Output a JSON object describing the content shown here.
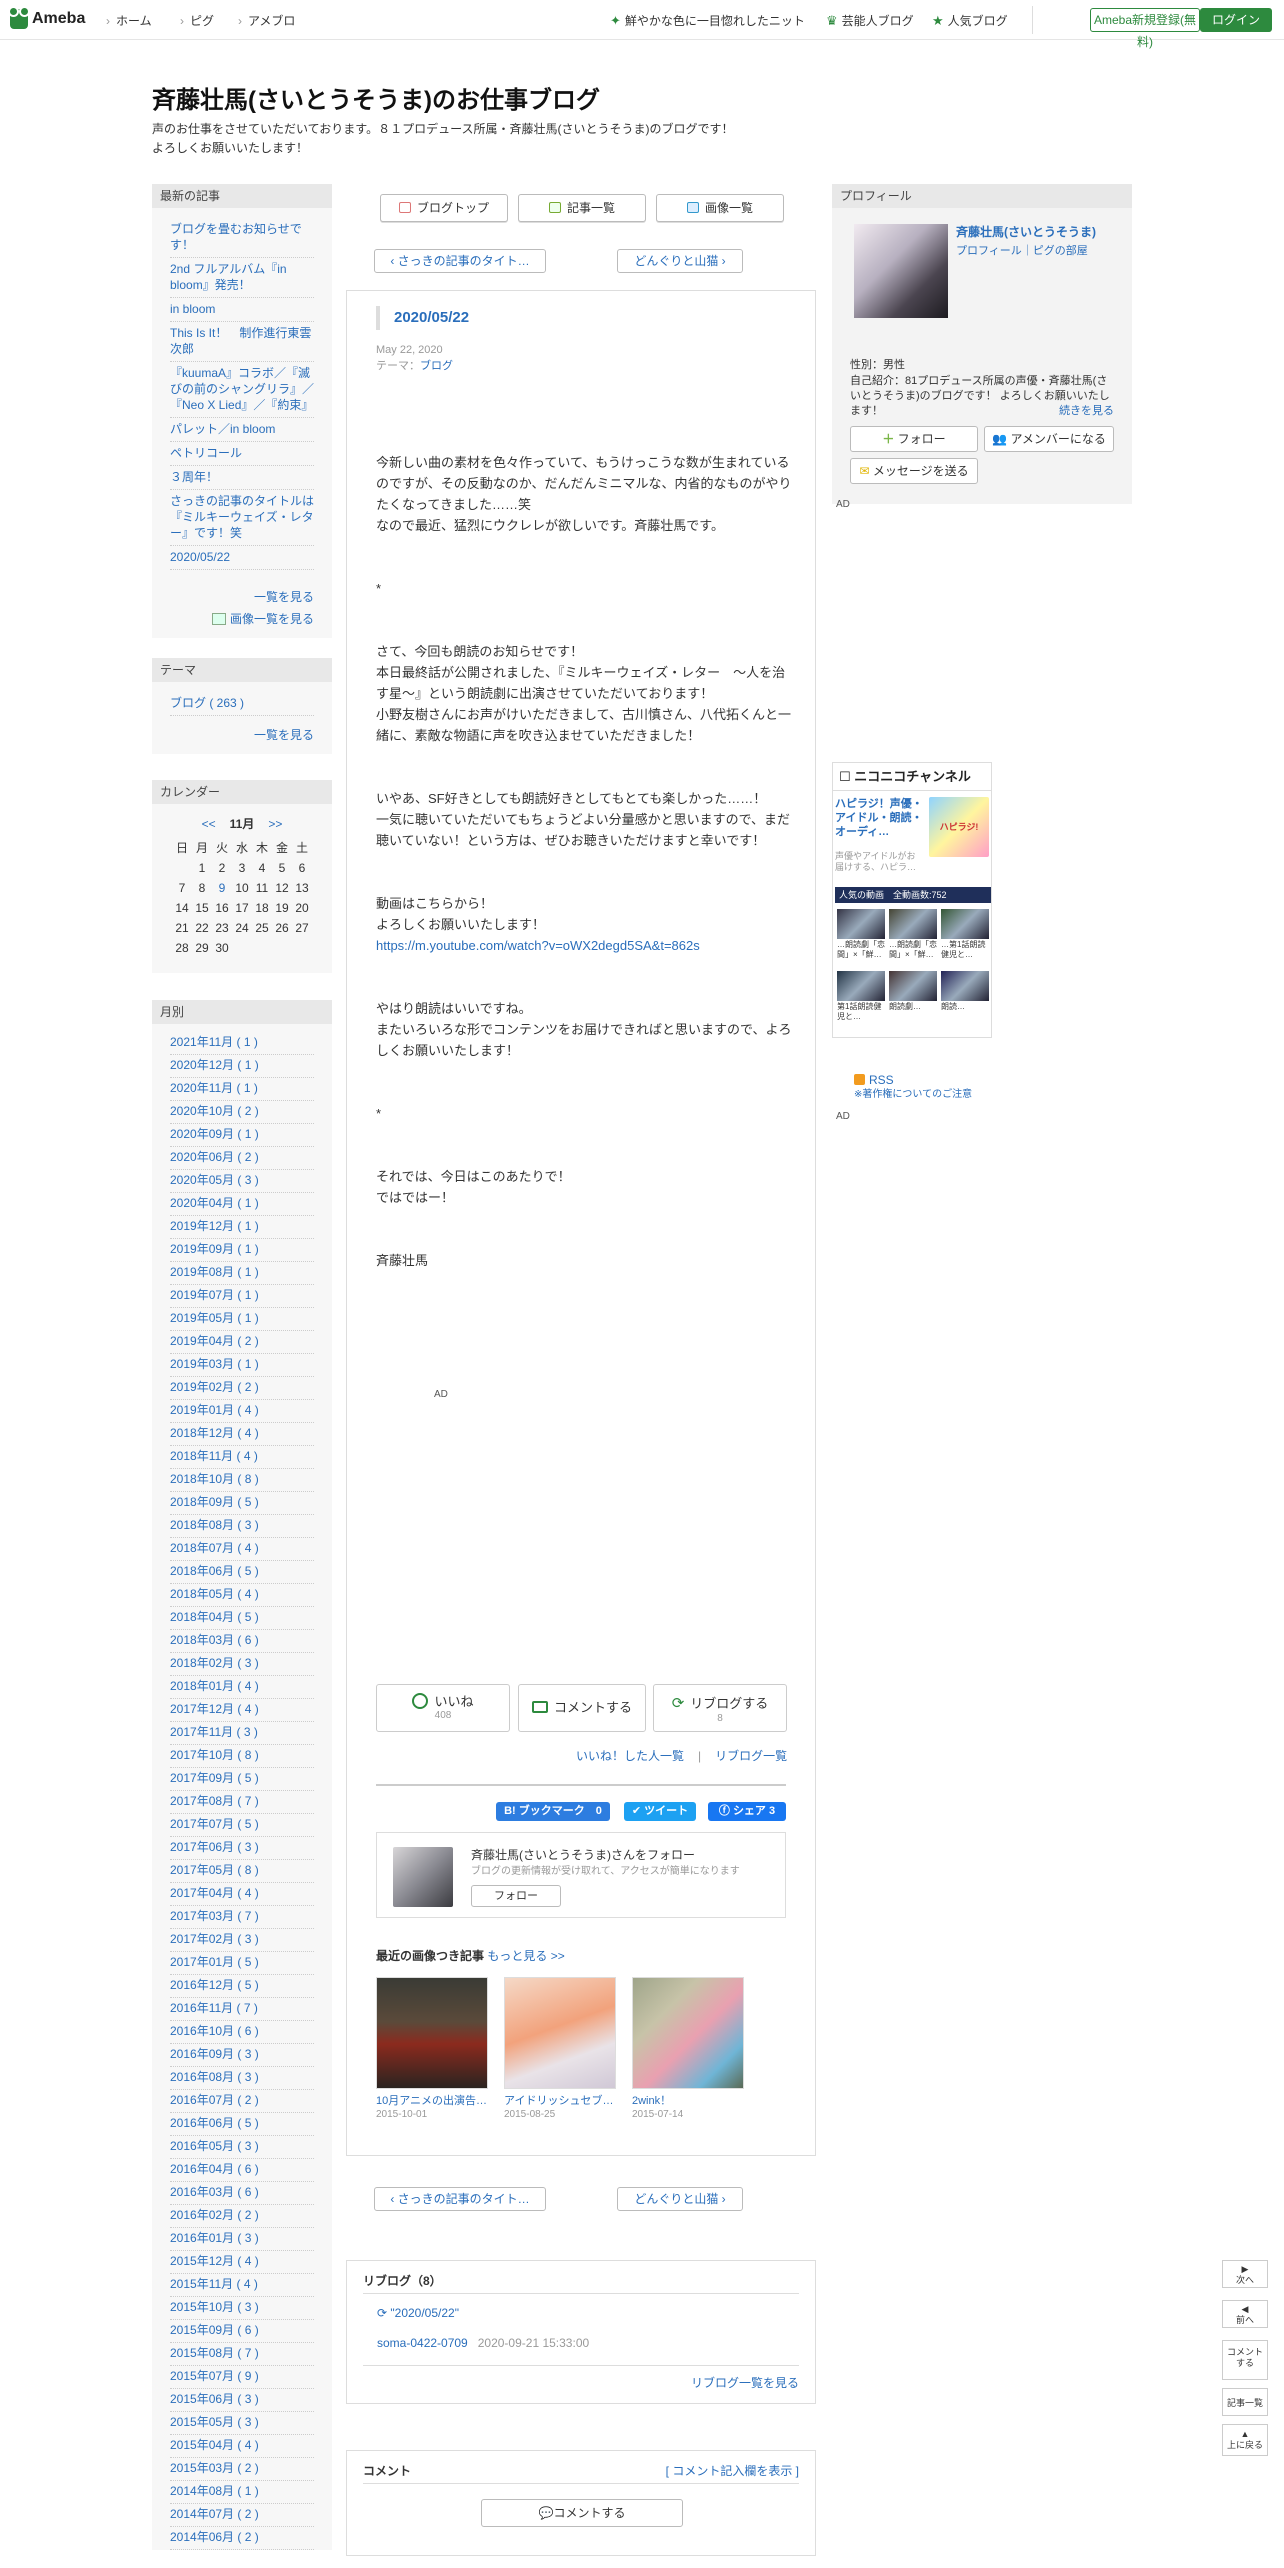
{
  "header": {
    "logo": "Ameba",
    "nav": [
      "ホーム",
      "ピグ",
      "アメブロ"
    ],
    "right_links": [
      "鮮やかな色に一目惚れしたニット",
      "芸能人ブログ",
      "人気ブログ"
    ],
    "register_label": "Ameba新規登録(無料)",
    "login_label": "ログイン"
  },
  "blog": {
    "title": "斉藤壮馬(さいとうそうま)のお仕事ブログ",
    "desc1": "声のお仕事をさせていただいております。８１プロデュース所属・斉藤壮馬(さいとうそうま)のブログです！",
    "desc2": "よろしくお願いいたします！"
  },
  "sidebar": {
    "recent_title": "最新の記事",
    "recent": [
      "ブログを畳むお知らせです！",
      "2nd フルアルバム『in bloom』発売！",
      "in bloom",
      "This Is It！　制作進行東雲次郎",
      "『kuumaA』コラボ／『滅びの前のシャングリラ』／『Neo X Lied』／『約束』",
      "パレット／in bloom",
      "ペトリコール",
      "３周年！",
      "さっきの記事のタイトルは『ミルキーウェイズ・レター』です！笑",
      "2020/05/22"
    ],
    "more_list": "一覧を見る",
    "more_images": "画像一覧を見る",
    "theme_title": "テーマ",
    "theme_item": "ブログ ( 263 )",
    "theme_more": "一覧を見る",
    "calendar_title": "カレンダー",
    "cal_prev": "<<",
    "cal_month": "11月",
    "cal_next": ">>",
    "cal_week": [
      "日",
      "月",
      "火",
      "水",
      "木",
      "金",
      "土"
    ],
    "cal_rows": [
      [
        "",
        "1",
        "2",
        "3",
        "4",
        "5",
        "6"
      ],
      [
        "7",
        "8",
        "9",
        "10",
        "11",
        "12",
        "13"
      ],
      [
        "14",
        "15",
        "16",
        "17",
        "18",
        "19",
        "20"
      ],
      [
        "21",
        "22",
        "23",
        "24",
        "25",
        "26",
        "27"
      ],
      [
        "28",
        "29",
        "30",
        "",
        "",
        "",
        ""
      ]
    ],
    "monthly_title": "月別",
    "monthly": [
      "2021年11月 ( 1 )",
      "2020年12月 ( 1 )",
      "2020年11月 ( 1 )",
      "2020年10月 ( 2 )",
      "2020年09月 ( 1 )",
      "2020年06月 ( 2 )",
      "2020年05月 ( 3 )",
      "2020年04月 ( 1 )",
      "2019年12月 ( 1 )",
      "2019年09月 ( 1 )",
      "2019年08月 ( 1 )",
      "2019年07月 ( 1 )",
      "2019年05月 ( 1 )",
      "2019年04月 ( 2 )",
      "2019年03月 ( 1 )",
      "2019年02月 ( 2 )",
      "2019年01月 ( 4 )",
      "2018年12月 ( 4 )",
      "2018年11月 ( 4 )",
      "2018年10月 ( 8 )",
      "2018年09月 ( 5 )",
      "2018年08月 ( 3 )",
      "2018年07月 ( 4 )",
      "2018年06月 ( 5 )",
      "2018年05月 ( 4 )",
      "2018年04月 ( 5 )",
      "2018年03月 ( 6 )",
      "2018年02月 ( 3 )",
      "2018年01月 ( 4 )",
      "2017年12月 ( 4 )",
      "2017年11月 ( 3 )",
      "2017年10月 ( 8 )",
      "2017年09月 ( 5 )",
      "2017年08月 ( 7 )",
      "2017年07月 ( 5 )",
      "2017年06月 ( 3 )",
      "2017年05月 ( 8 )",
      "2017年04月 ( 4 )",
      "2017年03月 ( 7 )",
      "2017年02月 ( 3 )",
      "2017年01月 ( 5 )",
      "2016年12月 ( 5 )",
      "2016年11月 ( 7 )",
      "2016年10月 ( 6 )",
      "2016年09月 ( 3 )",
      "2016年08月 ( 3 )",
      "2016年07月 ( 2 )",
      "2016年06月 ( 5 )",
      "2016年05月 ( 3 )",
      "2016年04月 ( 6 )",
      "2016年03月 ( 6 )",
      "2016年02月 ( 2 )",
      "2016年01月 ( 3 )",
      "2015年12月 ( 4 )",
      "2015年11月 ( 4 )",
      "2015年10月 ( 3 )",
      "2015年09月 ( 6 )",
      "2015年08月 ( 7 )",
      "2015年07月 ( 9 )",
      "2015年06月 ( 3 )",
      "2015年05月 ( 3 )",
      "2015年04月 ( 4 )",
      "2015年03月 ( 2 )",
      "2014年08月 ( 1 )",
      "2014年07月 ( 2 )",
      "2014年06月 ( 2 )"
    ]
  },
  "tabs": [
    "ブログトップ",
    "記事一覧",
    "画像一覧"
  ],
  "nav_prev": "さっきの記事のタイト…",
  "nav_next": "どんぐりと山猫",
  "entry": {
    "title": "2020/05/22",
    "date": "May 22, 2020",
    "theme_label": "テーマ：",
    "theme": "ブログ",
    "p1a": "今新しい曲の素材を色々作っていて、もうけっこうな数が生まれているのですが、その反動なのか、だんだんミニマルな、内省的なものがやりたくなってきました……笑",
    "p1b": "なので最近、猛烈にウクレレが欲しいです。斉藤壮馬です。",
    "star1": "*",
    "p2a": "さて、今回も朗読のお知らせです！",
    "p2b": "本日最終話が公開されました、『ミルキーウェイズ・レター　〜人を治す星〜』という朗読劇に出演させていただいております！",
    "p2c": "小野友樹さんにお声がけいただきまして、古川慎さん、八代拓くんと一緒に、素敵な物語に声を吹き込ませていただきました！",
    "p3a": "いやあ、SF好きとしても朗読好きとしてもとても楽しかった……！",
    "p3b": "一気に聴いていただいてもちょうどよい分量感かと思いますので、まだ聴いていない！という方は、ぜひお聴きいただけますと幸いです！",
    "p4a": "動画はこちらから！",
    "p4b": "よろしくお願いいたします！",
    "p4url": "https://m.youtube.com/watch?v=oWX2degd5SA&t=862s",
    "p5a": "やはり朗読はいいですね。",
    "p5b": "またいろいろな形でコンテンツをお届けできればと思いますので、よろしくお願いいたします！",
    "star2": "*",
    "p6a": "それでは、今日はこのあたりで！",
    "p6b": "ではではー！",
    "sign": "斉藤壮馬",
    "ad": "AD"
  },
  "actions": {
    "like": "いいね",
    "like_count": "408",
    "comment": "コメントする",
    "reblog": "リブログする",
    "reblog_count": "8",
    "liked_users": "いいね！した人一覧",
    "sep": "|",
    "reblog_list": "リブログ一覧",
    "hatena": "B! ブックマーク　0",
    "tweet": "ツイート",
    "share": "シェア 3"
  },
  "follow": {
    "title": "斉藤壮馬(さいとうそうま)さんをフォロー",
    "sub": "ブログの更新情報が受け取れて、アクセスが簡単になります",
    "button": "フォロー"
  },
  "recent_images": {
    "title": "最近の画像つき記事",
    "more": "もっと見る >>",
    "items": [
      {
        "caption": "10月アニメの出演告…",
        "date": "2015-10-01"
      },
      {
        "caption": "アイドリッシュセブ…",
        "date": "2015-08-25"
      },
      {
        "caption": "2wink！",
        "date": "2015-07-14"
      }
    ]
  },
  "reblogs": {
    "title": "リブログ（8）",
    "item": "\"2020/05/22\"",
    "user": "soma-0422-0709",
    "time": "2020-09-21 15:33:00",
    "more": "リブログ一覧を見る"
  },
  "comments": {
    "title": "コメント",
    "show": "[ コメント記入欄を表示 ]",
    "button": "コメントする"
  },
  "profile": {
    "title": "プロフィール",
    "name": "斉藤壮馬(さいとうそうま)",
    "links": "プロフィール｜ピグの部屋",
    "gender": "性別：男性",
    "intro": "自己紹介：81プロデュース所属の声優・斉藤壮馬(さいとうそうま)のブログです！ よろしくお願いいたします！",
    "more": "続きを見る",
    "follow": "フォロー",
    "member": "アメンバーになる",
    "message": "メッセージを送る",
    "ad": "AD"
  },
  "nico": {
    "brand": "ニコニコチャンネル",
    "headline": "ハピラジ！声優・アイドル・朗読・オーディ…",
    "sub": "声優やアイドルがお届けする、ハピラ…",
    "thumb_label": "ハピラジ!",
    "bar": "人気の動画",
    "bar_count": "全動画数:752",
    "videos": [
      "…朗読劇「恋間」×「鮮…",
      "…朗読劇「恋間」×「鮮…",
      "…第1話朗読健児と…",
      "第1話朗読健児と…",
      "朗読劇…",
      "朗読…"
    ],
    "rss": "RSS",
    "copyright": "※著作権についてのご注意",
    "ad": "AD"
  },
  "fixed": [
    "次へ",
    "前へ",
    "コメントする",
    "記事一覧",
    "上に戻る"
  ],
  "colors": {
    "ameba_green": "#2d8a3e",
    "link": "#2a6ebb"
  }
}
